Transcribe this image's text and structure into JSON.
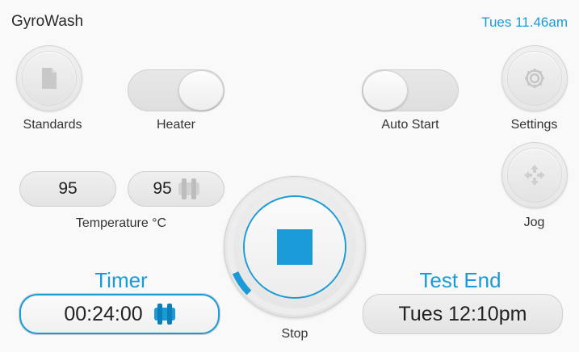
{
  "app": {
    "title": "GyroWash"
  },
  "clock": {
    "text": "Tues  11.46am"
  },
  "buttons": {
    "standards": {
      "label": "Standards",
      "icon": "document-icon"
    },
    "settings": {
      "label": "Settings",
      "icon": "gear-icon"
    },
    "jog": {
      "label": "Jog",
      "icon": "move-arrows-icon"
    },
    "stop": {
      "label": "Stop",
      "icon": "stop-square-icon"
    }
  },
  "toggles": {
    "heater": {
      "label": "Heater",
      "state": "on"
    },
    "auto_start": {
      "label": "Auto Start",
      "state": "off"
    }
  },
  "temperature": {
    "label": "Temperature °C",
    "actual_value": "95",
    "setpoint_value": "95"
  },
  "timer": {
    "title": "Timer",
    "value": "00:24:00"
  },
  "test_end": {
    "title": "Test End",
    "value": "Tues  12:10pm"
  },
  "progress": {
    "fraction": 0.06
  },
  "colors": {
    "accent": "#1a9bd7",
    "accent_dark": "#0d7fb8",
    "text": "#333333",
    "muted_icon": "#c6c6c6"
  }
}
